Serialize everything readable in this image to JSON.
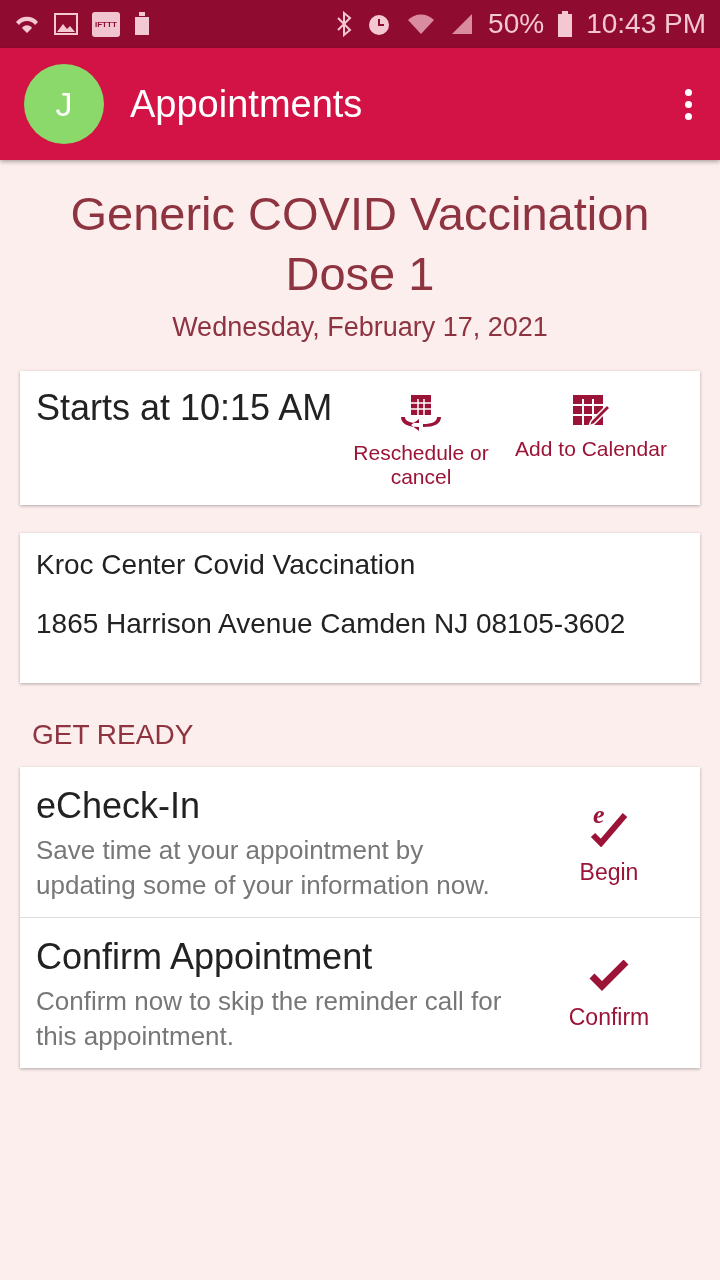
{
  "status_bar": {
    "app_badge": "IFTTT",
    "battery": "50%",
    "time": "10:43 PM"
  },
  "app_bar": {
    "avatar": "J",
    "title": "Appointments"
  },
  "appointment": {
    "title": "Generic COVID Vaccination Dose 1",
    "date": "Wednesday, February 17, 2021"
  },
  "time_card": {
    "starts": "Starts at 10:15 AM",
    "actions": [
      {
        "kind": "reschedule",
        "label": "Reschedule or cancel"
      },
      {
        "kind": "calendar",
        "label": "Add to Calendar"
      }
    ]
  },
  "location": {
    "name": "Kroc Center Covid Vaccination",
    "address": "1865 Harrison Avenue Camden NJ 08105-3602"
  },
  "section_title": "GET READY",
  "tasks": [
    {
      "kind": "echeckin",
      "title": "eCheck-In",
      "description": "Save time at your appointment by updating some of your information now.",
      "icon_letter": "e",
      "action": "Begin"
    },
    {
      "kind": "confirm",
      "title": "Confirm Appointment",
      "description": "Confirm now to skip the reminder call for this appointment.",
      "action": "Confirm"
    }
  ]
}
